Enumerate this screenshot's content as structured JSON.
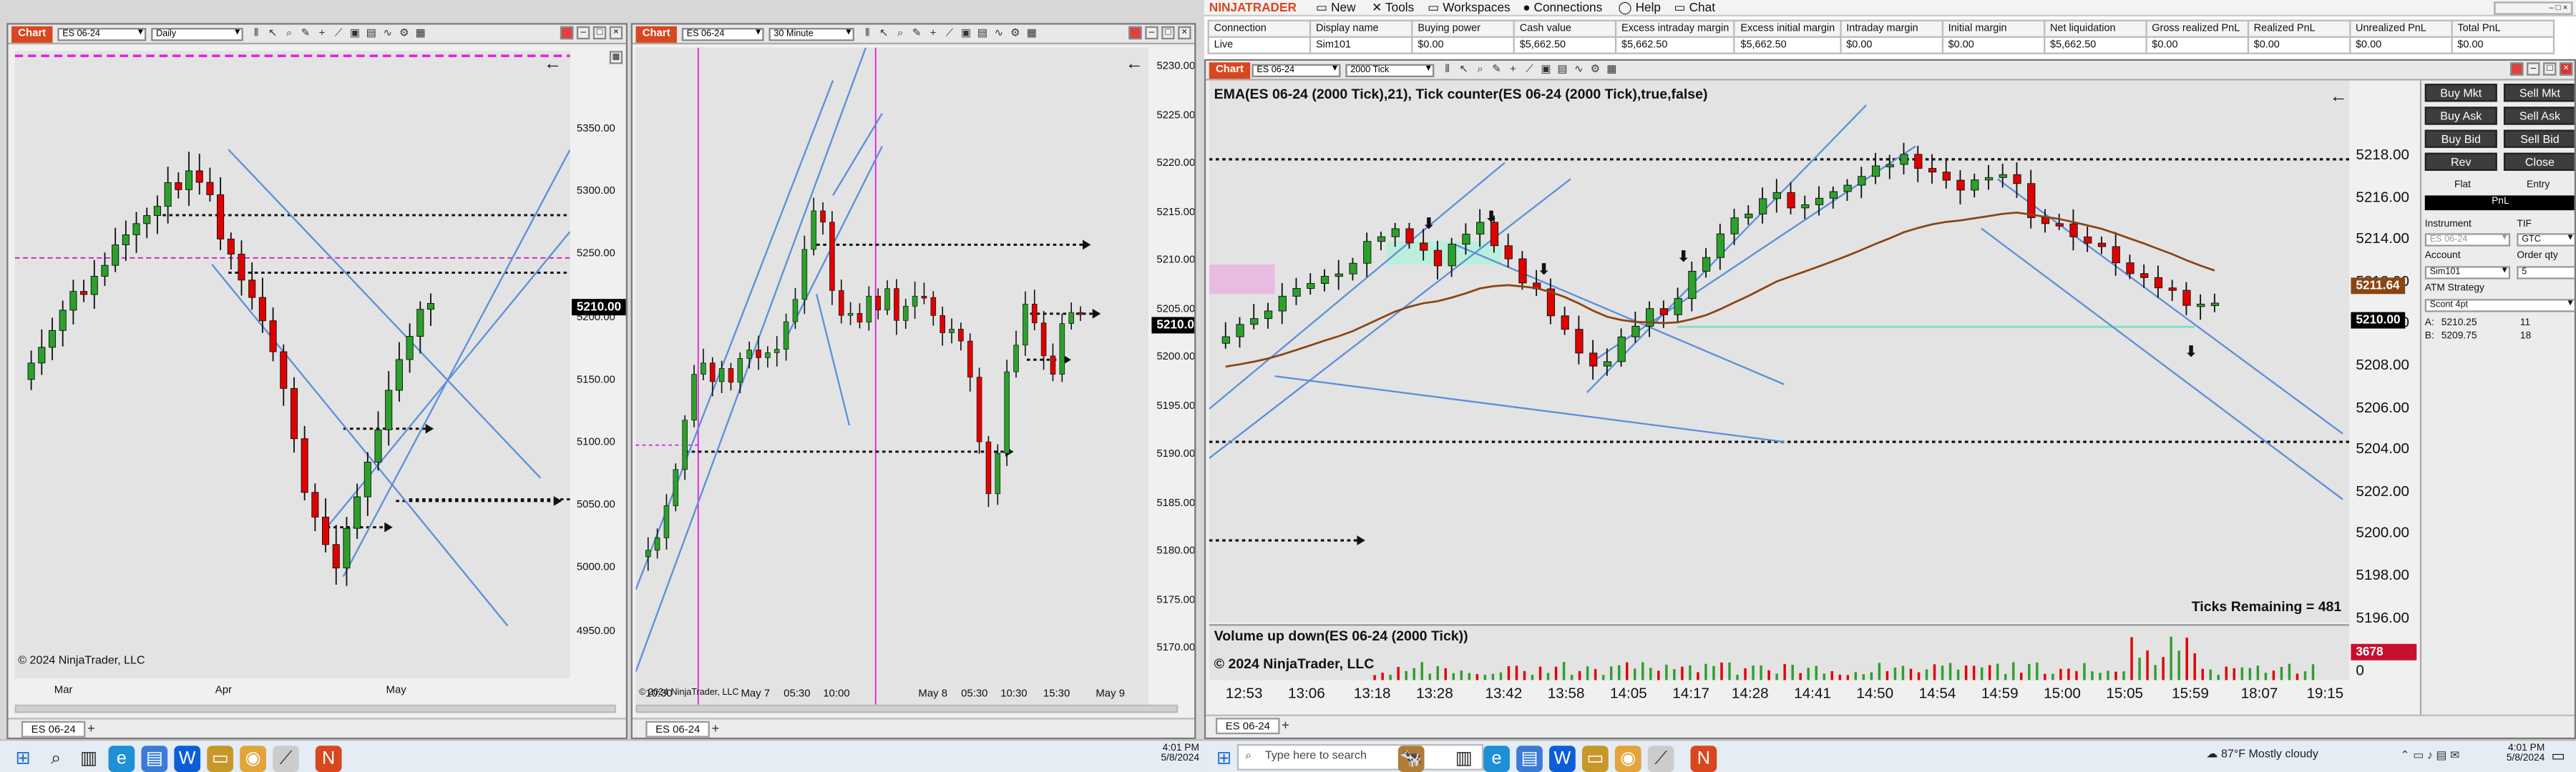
{
  "left_chart": {
    "tab": "Chart",
    "instrument": "ES 06-24",
    "interval": "Daily",
    "price_axis": [
      "5350.00",
      "5300.00",
      "5250.00",
      "5200.00",
      "5150.00",
      "5100.00",
      "5050.00",
      "5000.00",
      "4950.00"
    ],
    "current_price": "5210.00",
    "time_axis": [
      "Mar",
      "Apr",
      "May"
    ],
    "copyright": "© 2024 NinjaTrader, LLC",
    "instrument_tab": "ES 06-24"
  },
  "mid_chart": {
    "tab": "Chart",
    "instrument": "ES 06-24",
    "interval": "30 Minute",
    "price_axis": [
      "5230.00",
      "5225.00",
      "5220.00",
      "5215.00",
      "5210.00",
      "5205.00",
      "5200.00",
      "5195.00",
      "5190.00",
      "5185.00",
      "5180.00",
      "5175.00",
      "5170.00"
    ],
    "current_price": "5210.00",
    "time_axis": [
      "10:30",
      "May 7",
      "05:30",
      "10:00",
      "May 8",
      "05:30",
      "10:30",
      "15:30",
      "May 9"
    ],
    "copyright": "© 2024 NinjaTrader, LLC",
    "instrument_tab": "ES 06-24"
  },
  "ninjatrader": {
    "brand": "NINJATRADER",
    "menu": [
      "New",
      "Tools",
      "Workspaces",
      "Connections",
      "Help",
      "Chat"
    ],
    "accounts": {
      "headers": [
        "Connection",
        "Display name",
        "Buying power",
        "Cash value",
        "Excess intraday margin",
        "Excess initial margin",
        "Intraday margin",
        "Initial margin",
        "Net liquidation",
        "Gross realized PnL",
        "Realized PnL",
        "Unrealized PnL",
        "Total PnL"
      ],
      "row": [
        "Live",
        "Sim101",
        "$0.00",
        "$5,662.50",
        "$5,662.50",
        "$5,662.50",
        "$0.00",
        "$0.00",
        "$5,662.50",
        "$0.00",
        "$0.00",
        "$0.00",
        "$0.00"
      ]
    }
  },
  "right_chart": {
    "tab": "Chart",
    "instrument": "ES 06-24",
    "interval": "2000 Tick",
    "indicator_label": "EMA(ES 06-24 (2000 Tick),21), Tick counter(ES 06-24 (2000 Tick),true,false)",
    "price_axis": [
      "5218.00",
      "5216.00",
      "5214.00",
      "5212.00",
      "5210.00",
      "5208.00",
      "5206.00",
      "5204.00",
      "5202.00",
      "5200.00",
      "5198.00",
      "5196.00"
    ],
    "ema_price": "5211.64",
    "current_price": "5210.00",
    "ticks_remaining": "Ticks Remaining = 481",
    "volume_label": "Volume up down(ES 06-24 (2000 Tick))",
    "volume_value": "3678",
    "volume_zero": "0",
    "time_axis": [
      "12:53",
      "13:06",
      "13:18",
      "13:28",
      "13:42",
      "13:58",
      "14:05",
      "14:17",
      "14:28",
      "14:41",
      "14:50",
      "14:54",
      "14:59",
      "15:00",
      "15:05",
      "15:59",
      "18:07",
      "19:15"
    ],
    "copyright": "© 2024 NinjaTrader, LLC",
    "instrument_tab": "ES 06-24"
  },
  "chart_trader": {
    "buttons": [
      "Buy Mkt",
      "Sell Mkt",
      "Buy Ask",
      "Sell Ask",
      "Buy Bid",
      "Sell Bid",
      "Rev",
      "Close"
    ],
    "flat": "Flat",
    "entry": "Entry",
    "pnl": "PnL",
    "instrument_label": "Instrument",
    "instrument_value": "ES 06-24",
    "tif_label": "TIF",
    "tif_value": "GTC",
    "account_label": "Account",
    "account_value": "Sim101",
    "order_qty_label": "Order qty",
    "order_qty_value": "5",
    "atm_label": "ATM Strategy",
    "atm_value": "Scont 4pt",
    "ask_label": "A:",
    "ask_price": "5210.25",
    "ask_size": "11",
    "bid_label": "B:",
    "bid_price": "5209.75",
    "bid_size": "18"
  },
  "taskbar_left": {
    "time": "4:01 PM",
    "date": "5/8/2024"
  },
  "taskbar_right": {
    "search_placeholder": "Type here to search",
    "weather": "87°F  Mostly cloudy",
    "time": "4:01 PM",
    "date": "5/8/2024"
  },
  "colors": {
    "up": "#2ca02c",
    "down": "#e00000",
    "ema": "#8b4513",
    "trendline": "#5b8fd9",
    "accent": "#d9471f"
  }
}
